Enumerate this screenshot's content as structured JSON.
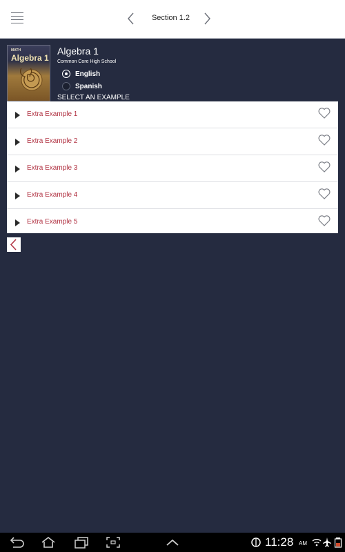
{
  "header": {
    "section_title": "Section 1.2",
    "menu_icon": "hamburger-icon",
    "prev_icon": "chevron-left-icon",
    "next_icon": "chevron-right-icon"
  },
  "book": {
    "cover_brand": "MATH",
    "cover_title": "Algebra 1",
    "title": "Algebra 1",
    "subtitle": "Common Core High School"
  },
  "languages": [
    {
      "label": "English",
      "selected": true
    },
    {
      "label": "Spanish",
      "selected": false
    }
  ],
  "select_label": "SELECT AN EXAMPLE",
  "examples": [
    {
      "label": "Extra Example 1"
    },
    {
      "label": "Extra Example 2"
    },
    {
      "label": "Extra Example 3"
    },
    {
      "label": "Extra Example 4"
    },
    {
      "label": "Extra Example 5"
    }
  ],
  "system_bar": {
    "time": "11:28",
    "ampm": "AM"
  },
  "colors": {
    "background": "#252b40",
    "example_text": "#b03040",
    "accent_red": "#b03040"
  }
}
